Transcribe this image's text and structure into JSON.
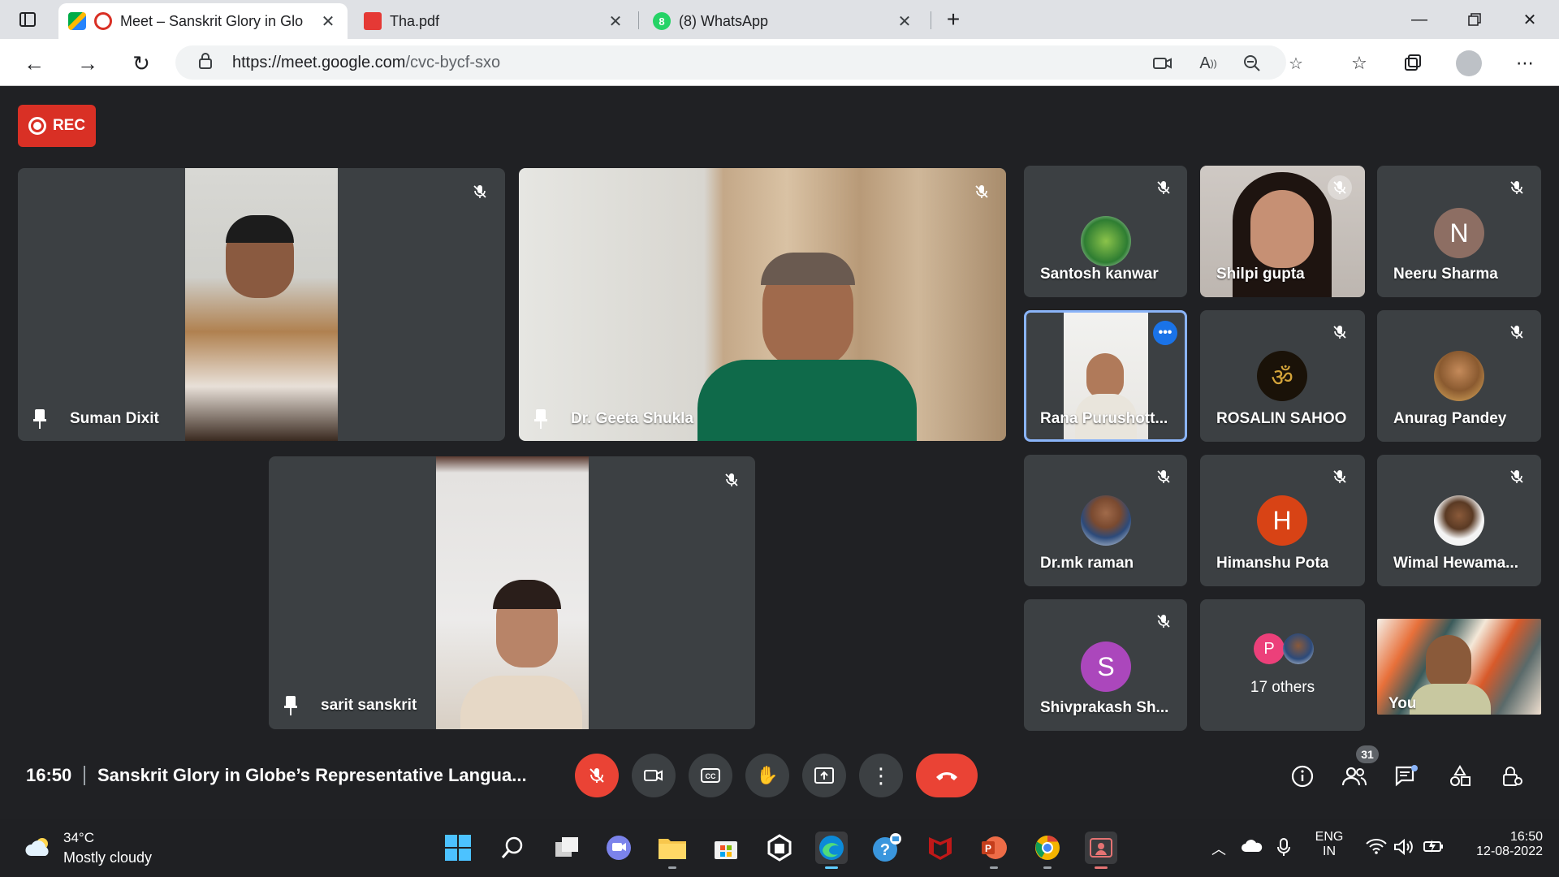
{
  "browser": {
    "tabs": [
      {
        "title": "Meet – Sanskrit Glory in Glo",
        "active": true
      },
      {
        "title": "Tha.pdf",
        "active": false
      },
      {
        "title": "(8) WhatsApp",
        "active": false
      }
    ],
    "whatsapp_badge": "8",
    "url_host": "https://meet.google.com",
    "url_path": "/cvc-bycf-sxo"
  },
  "meet": {
    "rec_label": "REC",
    "time": "16:50",
    "meeting_title": "Sanskrit Glory in Globe’s Representative Langua...",
    "participants_count": "31",
    "large_tiles": [
      {
        "name": "Suman Dixit"
      },
      {
        "name": "Dr. Geeta Shukla"
      },
      {
        "name": "sarit sanskrit"
      }
    ],
    "small_tiles": [
      {
        "name": "Santosh kanwar"
      },
      {
        "name": "Shilpi gupta"
      },
      {
        "name": "Neeru Sharma",
        "initial": "N"
      },
      {
        "name": "Rana Purushott..."
      },
      {
        "name": "ROSALIN SAHOO"
      },
      {
        "name": "Anurag Pandey"
      },
      {
        "name": "Dr.mk raman"
      },
      {
        "name": "Himanshu Pota",
        "initial": "H"
      },
      {
        "name": "Wimal Hewama..."
      },
      {
        "name": "Shivprakash Sh...",
        "initial": "S"
      },
      {
        "name": "17 others",
        "initial": "P"
      },
      {
        "name": "You"
      }
    ],
    "colors": {
      "neeru": "#8d6e63",
      "himanshu": "#d84315",
      "shivprakash": "#ab47bc",
      "others_p": "#ec407a",
      "active_border": "#8ab4f8",
      "more_dot": "#1a73e8",
      "end_call": "#ea4335"
    }
  },
  "taskbar": {
    "temperature": "34°C",
    "weather": "Mostly cloudy",
    "lang_top": "ENG",
    "lang_bottom": "IN",
    "clock_time": "16:50",
    "clock_date": "12-08-2022"
  }
}
